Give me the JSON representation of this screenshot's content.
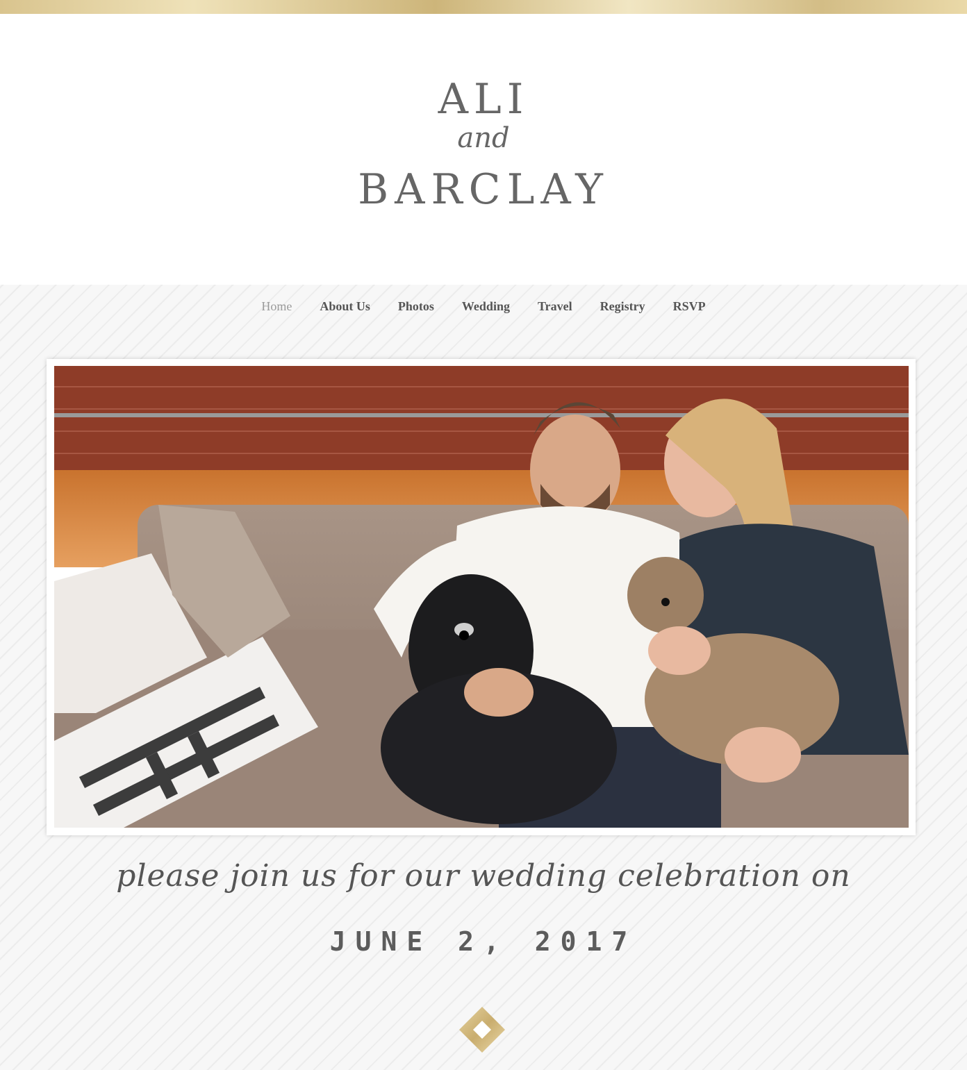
{
  "couple": {
    "name_one": "ALI",
    "connector": "and",
    "name_two": "BARCLAY"
  },
  "nav": {
    "items": [
      {
        "label": "Home",
        "active": true
      },
      {
        "label": "About Us",
        "active": false
      },
      {
        "label": "Photos",
        "active": false
      },
      {
        "label": "Wedding",
        "active": false
      },
      {
        "label": "Travel",
        "active": false
      },
      {
        "label": "Registry",
        "active": false
      },
      {
        "label": "RSVP",
        "active": false
      }
    ]
  },
  "invite": {
    "line": "please join us for our wedding celebration on",
    "date": "JUNE 2, 2017"
  },
  "colors": {
    "gold": "#d9c48e",
    "text": "#666666",
    "nav_active": "#9a9a9a"
  },
  "icons": {
    "divider": "gold-diamond-icon"
  }
}
